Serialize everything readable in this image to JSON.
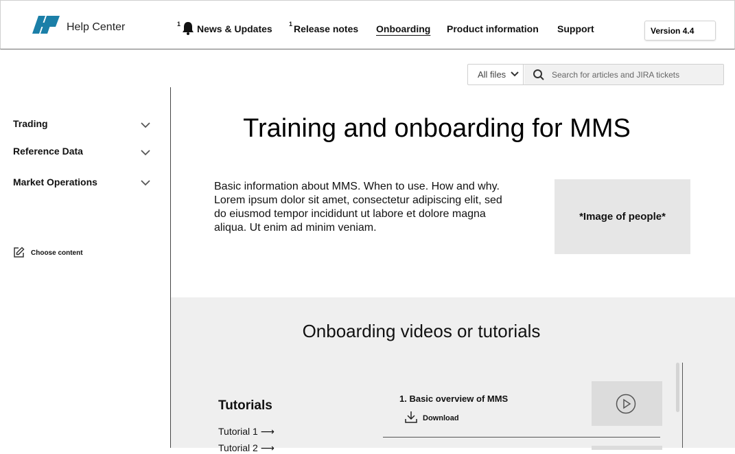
{
  "header": {
    "brand": "Help Center",
    "nav": [
      {
        "label": "News & Updates",
        "badge": "1"
      },
      {
        "label": "Release notes",
        "badge": "1"
      },
      {
        "label": "Onboarding",
        "active": true
      },
      {
        "label": "Product information"
      },
      {
        "label": "Support"
      }
    ],
    "version": "Version 4.4"
  },
  "search": {
    "filter": "All files",
    "placeholder": "Search for articles and JIRA tickets"
  },
  "sidebar": {
    "items": [
      {
        "label": "Trading"
      },
      {
        "label": "Reference Data"
      },
      {
        "label": "Market Operations"
      }
    ],
    "choose_content": "Choose content"
  },
  "main": {
    "title": "Training and onboarding for MMS",
    "intro": "Basic information about MMS. When to use. How and why. Lorem ipsum dolor sit amet, consectetur adipiscing elit, sed do eiusmod tempor incididunt ut labore et dolore magna aliqua. Ut enim ad minim veniam.",
    "image_placeholder": "*Image of people*"
  },
  "videos": {
    "title": "Onboarding videos or tutorials",
    "tutorials_heading": "Tutorials",
    "tutorials": [
      "Tutorial 1 ⟶",
      "Tutorial 2 ⟶"
    ],
    "items": [
      {
        "title": "1. Basic overview of MMS",
        "download": "Download"
      }
    ]
  },
  "colors": {
    "logo": "#1b7fa8",
    "section_bg": "#efefef",
    "placeholder_bg": "#e6e6e6"
  }
}
